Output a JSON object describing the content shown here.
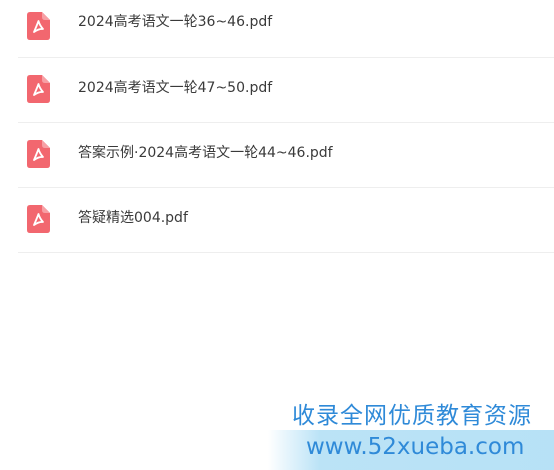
{
  "files": [
    {
      "name": "2024高考语文一轮36~46.pdf",
      "icon": "pdf-icon"
    },
    {
      "name": "2024高考语文一轮47~50.pdf",
      "icon": "pdf-icon"
    },
    {
      "name": "答案示例·2024高考语文一轮44~46.pdf",
      "icon": "pdf-icon"
    },
    {
      "name": "答疑精选004.pdf",
      "icon": "pdf-icon"
    }
  ],
  "watermark": {
    "line1": "收录全网优质教育资源",
    "line2": "www.52xueba.com"
  },
  "colors": {
    "pdf_icon": "#f2676f",
    "watermark_text": "#2f8ad8",
    "file_text": "#3a3a3a"
  }
}
